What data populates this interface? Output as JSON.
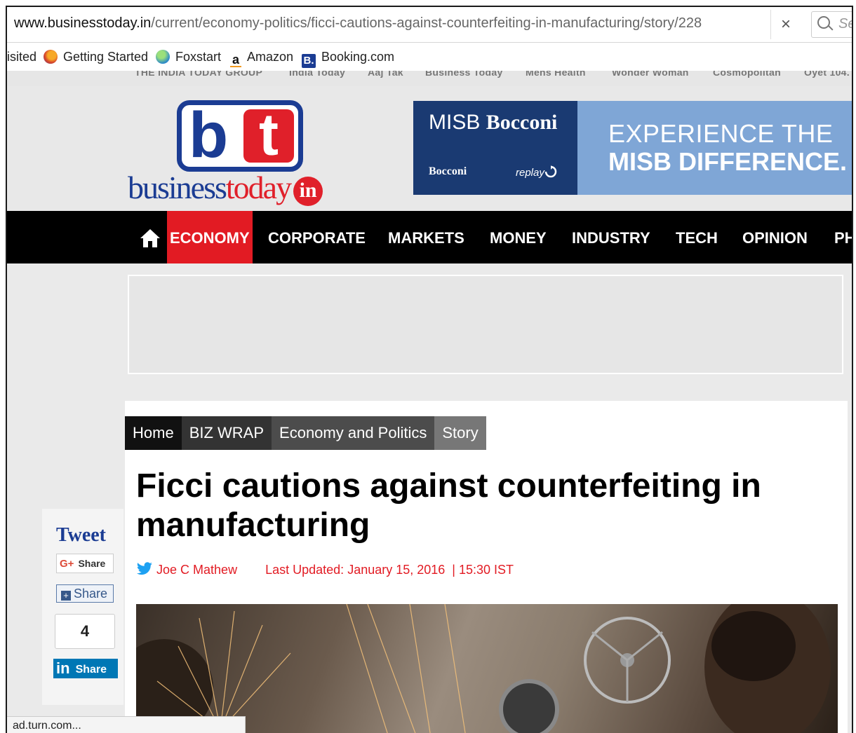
{
  "browser": {
    "url_host": "www.businesstoday.in",
    "url_path": "/current/economy-politics/ficci-cautions-against-counterfeiting-in-manufacturing/story/228",
    "clear_glyph": "×",
    "search_placeholder": "Se",
    "bookmarks": [
      {
        "label": "isited",
        "icon": "none"
      },
      {
        "label": "Getting Started",
        "icon": "firefox-icon"
      },
      {
        "label": "Foxstart",
        "icon": "globe-icon"
      },
      {
        "label": "Amazon",
        "icon": "amazon-icon"
      },
      {
        "label": "Booking.com",
        "icon": "booking-icon"
      }
    ],
    "status_text": "ad.turn.com..."
  },
  "group_bar": [
    "THE INDIA TODAY GROUP",
    "India Today",
    "Aaj Tak",
    "Business Today",
    "Mens Health",
    "Wonder Woman",
    "Cosmopolitan",
    "Oyet 104."
  ],
  "logo": {
    "letter_b": "b",
    "letter_t": "t",
    "word_business": "business",
    "word_today": "today",
    "word_in": "in"
  },
  "ad": {
    "misb_plain": "MISB ",
    "misb_bold": "Bocconi",
    "bocconi_small": "Bocconi",
    "replay": "replay",
    "line1": "EXPERIENCE THE",
    "line2": "MISB DIFFERENCE."
  },
  "nav": {
    "items": [
      "ECONOMY",
      "CORPORATE",
      "MARKETS",
      "MONEY",
      "INDUSTRY",
      "TECH",
      "OPINION",
      "PH"
    ],
    "active": "ECONOMY"
  },
  "breadcrumb": [
    "Home",
    "BIZ WRAP",
    "Economy and Politics",
    "Story"
  ],
  "article": {
    "headline": "Ficci cautions against counterfeiting in manufacturing",
    "author": "Joe C Mathew",
    "updated": "Last Updated: January 15, 2016  | 15:30 IST"
  },
  "share": {
    "tweet": "Tweet",
    "gplus_glyph": "G+",
    "gplus_label": "Share",
    "share_label": "Share",
    "count": "4",
    "linkedin_glyph": "in",
    "linkedin_label": "Share"
  },
  "colors": {
    "brand_blue": "#1b3c93",
    "brand_red": "#e21b23",
    "nav_bg": "#000000"
  }
}
